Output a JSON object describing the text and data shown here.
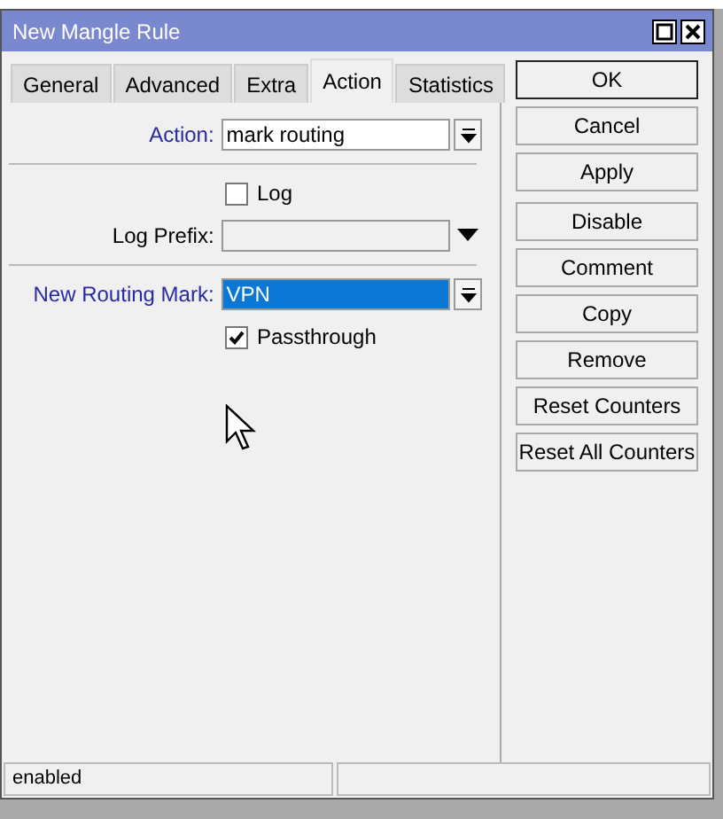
{
  "window": {
    "title": "New Mangle Rule"
  },
  "tabs": [
    {
      "label": "General",
      "selected": false
    },
    {
      "label": "Advanced",
      "selected": false
    },
    {
      "label": "Extra",
      "selected": false
    },
    {
      "label": "Action",
      "selected": true
    },
    {
      "label": "Statistics",
      "selected": false
    }
  ],
  "form": {
    "action": {
      "label": "Action:",
      "value": "mark routing"
    },
    "log": {
      "label": "Log",
      "checked": false
    },
    "log_prefix": {
      "label": "Log Prefix:",
      "disabled": true
    },
    "new_routing_mark": {
      "label": "New Routing Mark:",
      "value": "VPN",
      "selected": true
    },
    "passthrough": {
      "label": "Passthrough",
      "checked": true
    }
  },
  "button_groups": [
    [
      {
        "label": "OK",
        "default": true
      },
      {
        "label": "Cancel",
        "default": false
      },
      {
        "label": "Apply",
        "default": false
      }
    ],
    [
      {
        "label": "Disable",
        "default": false
      },
      {
        "label": "Comment",
        "default": false
      },
      {
        "label": "Copy",
        "default": false
      },
      {
        "label": "Remove",
        "default": false
      },
      {
        "label": "Reset Counters",
        "default": false
      },
      {
        "label": "Reset All Counters",
        "default": false
      }
    ]
  ],
  "status_bar": [
    "enabled"
  ]
}
